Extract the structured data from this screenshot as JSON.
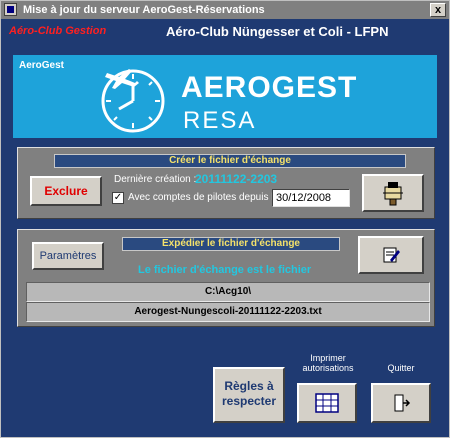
{
  "window": {
    "title": "Mise à jour du serveur AeroGest-Réservations",
    "close_glyph": "x"
  },
  "header": {
    "club_label": "Aéro-Club Gestion",
    "site_title": "Aéro-Club Nüngesser et Coli - LFPN"
  },
  "banner": {
    "label": "AeroGest",
    "logo_word1": "AEROGEST",
    "logo_word2": "RESA"
  },
  "create_panel": {
    "title": "Créer le fichier d'échange",
    "exclude_label": "Exclure",
    "last_creation_label": "Dernière création :",
    "last_creation_value": "20111122-2203",
    "checkbox_checked": true,
    "checkbox_label": "Avec comptes de pilotes depuis le :",
    "date_value": "30/12/2008"
  },
  "send_panel": {
    "title": "Expédier le fichier d'échange",
    "params_label": "Paramètres",
    "info_text": "Le fichier d'échange est le fichier",
    "path_value": "C:\\Acg10\\",
    "file_value": "Aerogest-Nungescoli-20111122-2203.txt"
  },
  "footer": {
    "rules_label": "Règles à respecter",
    "print_label": "Imprimer autorisations",
    "quit_label": "Quitter"
  },
  "colors": {
    "background": "#1f3a72",
    "banner": "#1ea3da",
    "accent_cyan": "#22c7e0",
    "panel_title_text": "#f5e26a",
    "club_red": "#ff2020"
  }
}
